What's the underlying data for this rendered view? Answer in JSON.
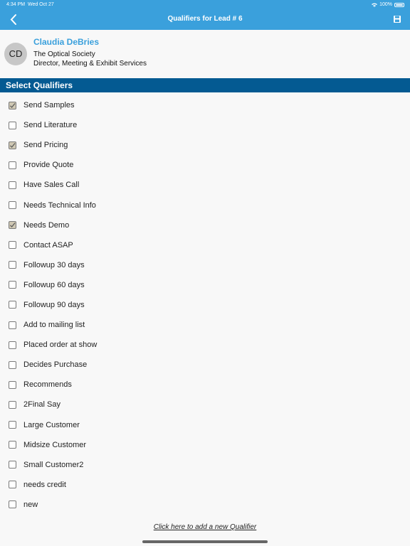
{
  "status_bar": {
    "time": "4:34 PM",
    "date": "Wed Oct 27",
    "battery": "100%"
  },
  "nav": {
    "title": "Qualifiers for Lead # 6"
  },
  "contact": {
    "initials": "CD",
    "name": "Claudia DeBries",
    "organization": "The Optical Society",
    "job_title": "Director, Meeting & Exhibit Services"
  },
  "section": {
    "title": "Select Qualifiers"
  },
  "qualifiers": [
    {
      "label": "Send Samples",
      "checked": true
    },
    {
      "label": "Send Literature",
      "checked": false
    },
    {
      "label": "Send Pricing",
      "checked": true
    },
    {
      "label": "Provide Quote",
      "checked": false
    },
    {
      "label": "Have Sales Call",
      "checked": false
    },
    {
      "label": "Needs Technical Info",
      "checked": false
    },
    {
      "label": "Needs Demo",
      "checked": true
    },
    {
      "label": "Contact ASAP",
      "checked": false
    },
    {
      "label": "Followup 30 days",
      "checked": false
    },
    {
      "label": "Followup 60 days",
      "checked": false
    },
    {
      "label": "Followup 90 days",
      "checked": false
    },
    {
      "label": "Add to mailing list",
      "checked": false
    },
    {
      "label": "Placed order at show",
      "checked": false
    },
    {
      "label": "Decides Purchase",
      "checked": false
    },
    {
      "label": "Recommends",
      "checked": false
    },
    {
      "label": "2Final Say",
      "checked": false
    },
    {
      "label": "Large Customer",
      "checked": false
    },
    {
      "label": "Midsize Customer",
      "checked": false
    },
    {
      "label": "Small Customer2",
      "checked": false
    },
    {
      "label": "needs credit",
      "checked": false
    },
    {
      "label": "new",
      "checked": false
    }
  ],
  "footer": {
    "add_link": "Click here to add a new Qualifier"
  },
  "colors": {
    "nav": "#3aa0dc",
    "section_header": "#045a92",
    "name": "#3aa0dc"
  },
  "icons": {
    "back": "chevron-left-icon",
    "save": "save-icon",
    "wifi": "wifi-icon",
    "battery": "battery-icon",
    "check": "check-icon"
  }
}
